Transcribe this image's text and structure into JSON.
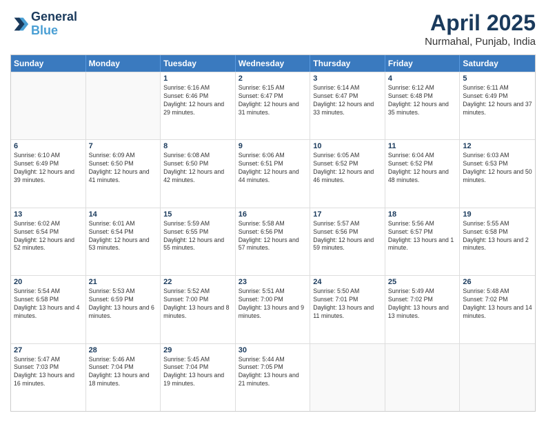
{
  "header": {
    "logo_line1": "General",
    "logo_line2": "Blue",
    "month_title": "April 2025",
    "location": "Nurmahal, Punjab, India"
  },
  "days_of_week": [
    "Sunday",
    "Monday",
    "Tuesday",
    "Wednesday",
    "Thursday",
    "Friday",
    "Saturday"
  ],
  "weeks": [
    [
      {
        "day": "",
        "sunrise": "",
        "sunset": "",
        "daylight": "",
        "empty": true
      },
      {
        "day": "",
        "sunrise": "",
        "sunset": "",
        "daylight": "",
        "empty": true
      },
      {
        "day": "1",
        "sunrise": "Sunrise: 6:16 AM",
        "sunset": "Sunset: 6:46 PM",
        "daylight": "Daylight: 12 hours and 29 minutes."
      },
      {
        "day": "2",
        "sunrise": "Sunrise: 6:15 AM",
        "sunset": "Sunset: 6:47 PM",
        "daylight": "Daylight: 12 hours and 31 minutes."
      },
      {
        "day": "3",
        "sunrise": "Sunrise: 6:14 AM",
        "sunset": "Sunset: 6:47 PM",
        "daylight": "Daylight: 12 hours and 33 minutes."
      },
      {
        "day": "4",
        "sunrise": "Sunrise: 6:12 AM",
        "sunset": "Sunset: 6:48 PM",
        "daylight": "Daylight: 12 hours and 35 minutes."
      },
      {
        "day": "5",
        "sunrise": "Sunrise: 6:11 AM",
        "sunset": "Sunset: 6:49 PM",
        "daylight": "Daylight: 12 hours and 37 minutes."
      }
    ],
    [
      {
        "day": "6",
        "sunrise": "Sunrise: 6:10 AM",
        "sunset": "Sunset: 6:49 PM",
        "daylight": "Daylight: 12 hours and 39 minutes."
      },
      {
        "day": "7",
        "sunrise": "Sunrise: 6:09 AM",
        "sunset": "Sunset: 6:50 PM",
        "daylight": "Daylight: 12 hours and 41 minutes."
      },
      {
        "day": "8",
        "sunrise": "Sunrise: 6:08 AM",
        "sunset": "Sunset: 6:50 PM",
        "daylight": "Daylight: 12 hours and 42 minutes."
      },
      {
        "day": "9",
        "sunrise": "Sunrise: 6:06 AM",
        "sunset": "Sunset: 6:51 PM",
        "daylight": "Daylight: 12 hours and 44 minutes."
      },
      {
        "day": "10",
        "sunrise": "Sunrise: 6:05 AM",
        "sunset": "Sunset: 6:52 PM",
        "daylight": "Daylight: 12 hours and 46 minutes."
      },
      {
        "day": "11",
        "sunrise": "Sunrise: 6:04 AM",
        "sunset": "Sunset: 6:52 PM",
        "daylight": "Daylight: 12 hours and 48 minutes."
      },
      {
        "day": "12",
        "sunrise": "Sunrise: 6:03 AM",
        "sunset": "Sunset: 6:53 PM",
        "daylight": "Daylight: 12 hours and 50 minutes."
      }
    ],
    [
      {
        "day": "13",
        "sunrise": "Sunrise: 6:02 AM",
        "sunset": "Sunset: 6:54 PM",
        "daylight": "Daylight: 12 hours and 52 minutes."
      },
      {
        "day": "14",
        "sunrise": "Sunrise: 6:01 AM",
        "sunset": "Sunset: 6:54 PM",
        "daylight": "Daylight: 12 hours and 53 minutes."
      },
      {
        "day": "15",
        "sunrise": "Sunrise: 5:59 AM",
        "sunset": "Sunset: 6:55 PM",
        "daylight": "Daylight: 12 hours and 55 minutes."
      },
      {
        "day": "16",
        "sunrise": "Sunrise: 5:58 AM",
        "sunset": "Sunset: 6:56 PM",
        "daylight": "Daylight: 12 hours and 57 minutes."
      },
      {
        "day": "17",
        "sunrise": "Sunrise: 5:57 AM",
        "sunset": "Sunset: 6:56 PM",
        "daylight": "Daylight: 12 hours and 59 minutes."
      },
      {
        "day": "18",
        "sunrise": "Sunrise: 5:56 AM",
        "sunset": "Sunset: 6:57 PM",
        "daylight": "Daylight: 13 hours and 1 minute."
      },
      {
        "day": "19",
        "sunrise": "Sunrise: 5:55 AM",
        "sunset": "Sunset: 6:58 PM",
        "daylight": "Daylight: 13 hours and 2 minutes."
      }
    ],
    [
      {
        "day": "20",
        "sunrise": "Sunrise: 5:54 AM",
        "sunset": "Sunset: 6:58 PM",
        "daylight": "Daylight: 13 hours and 4 minutes."
      },
      {
        "day": "21",
        "sunrise": "Sunrise: 5:53 AM",
        "sunset": "Sunset: 6:59 PM",
        "daylight": "Daylight: 13 hours and 6 minutes."
      },
      {
        "day": "22",
        "sunrise": "Sunrise: 5:52 AM",
        "sunset": "Sunset: 7:00 PM",
        "daylight": "Daylight: 13 hours and 8 minutes."
      },
      {
        "day": "23",
        "sunrise": "Sunrise: 5:51 AM",
        "sunset": "Sunset: 7:00 PM",
        "daylight": "Daylight: 13 hours and 9 minutes."
      },
      {
        "day": "24",
        "sunrise": "Sunrise: 5:50 AM",
        "sunset": "Sunset: 7:01 PM",
        "daylight": "Daylight: 13 hours and 11 minutes."
      },
      {
        "day": "25",
        "sunrise": "Sunrise: 5:49 AM",
        "sunset": "Sunset: 7:02 PM",
        "daylight": "Daylight: 13 hours and 13 minutes."
      },
      {
        "day": "26",
        "sunrise": "Sunrise: 5:48 AM",
        "sunset": "Sunset: 7:02 PM",
        "daylight": "Daylight: 13 hours and 14 minutes."
      }
    ],
    [
      {
        "day": "27",
        "sunrise": "Sunrise: 5:47 AM",
        "sunset": "Sunset: 7:03 PM",
        "daylight": "Daylight: 13 hours and 16 minutes."
      },
      {
        "day": "28",
        "sunrise": "Sunrise: 5:46 AM",
        "sunset": "Sunset: 7:04 PM",
        "daylight": "Daylight: 13 hours and 18 minutes."
      },
      {
        "day": "29",
        "sunrise": "Sunrise: 5:45 AM",
        "sunset": "Sunset: 7:04 PM",
        "daylight": "Daylight: 13 hours and 19 minutes."
      },
      {
        "day": "30",
        "sunrise": "Sunrise: 5:44 AM",
        "sunset": "Sunset: 7:05 PM",
        "daylight": "Daylight: 13 hours and 21 minutes."
      },
      {
        "day": "",
        "sunrise": "",
        "sunset": "",
        "daylight": "",
        "empty": true
      },
      {
        "day": "",
        "sunrise": "",
        "sunset": "",
        "daylight": "",
        "empty": true
      },
      {
        "day": "",
        "sunrise": "",
        "sunset": "",
        "daylight": "",
        "empty": true
      }
    ]
  ]
}
